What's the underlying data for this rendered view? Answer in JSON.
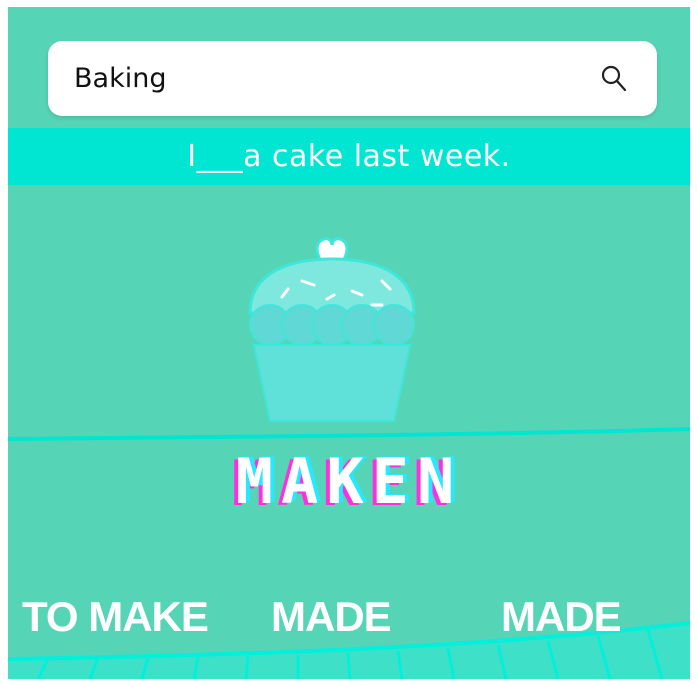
{
  "search": {
    "value": "Baking"
  },
  "prompt": {
    "sentence": "I___a cake last week."
  },
  "word": {
    "text": "MAKEN"
  },
  "options": [
    {
      "label": "TO MAKE"
    },
    {
      "label": "MADE"
    },
    {
      "label": "MADE"
    }
  ],
  "colors": {
    "background": "#56d4b6",
    "band": "#00e6d2",
    "cupcake": "#5fe0d8",
    "cupcake_frosting": "#7ee8df",
    "accent_pink": "#ff2fe0",
    "accent_cyan": "#26e8ff"
  },
  "icons": [
    "search-icon",
    "heart-icon",
    "cupcake-illustration"
  ]
}
